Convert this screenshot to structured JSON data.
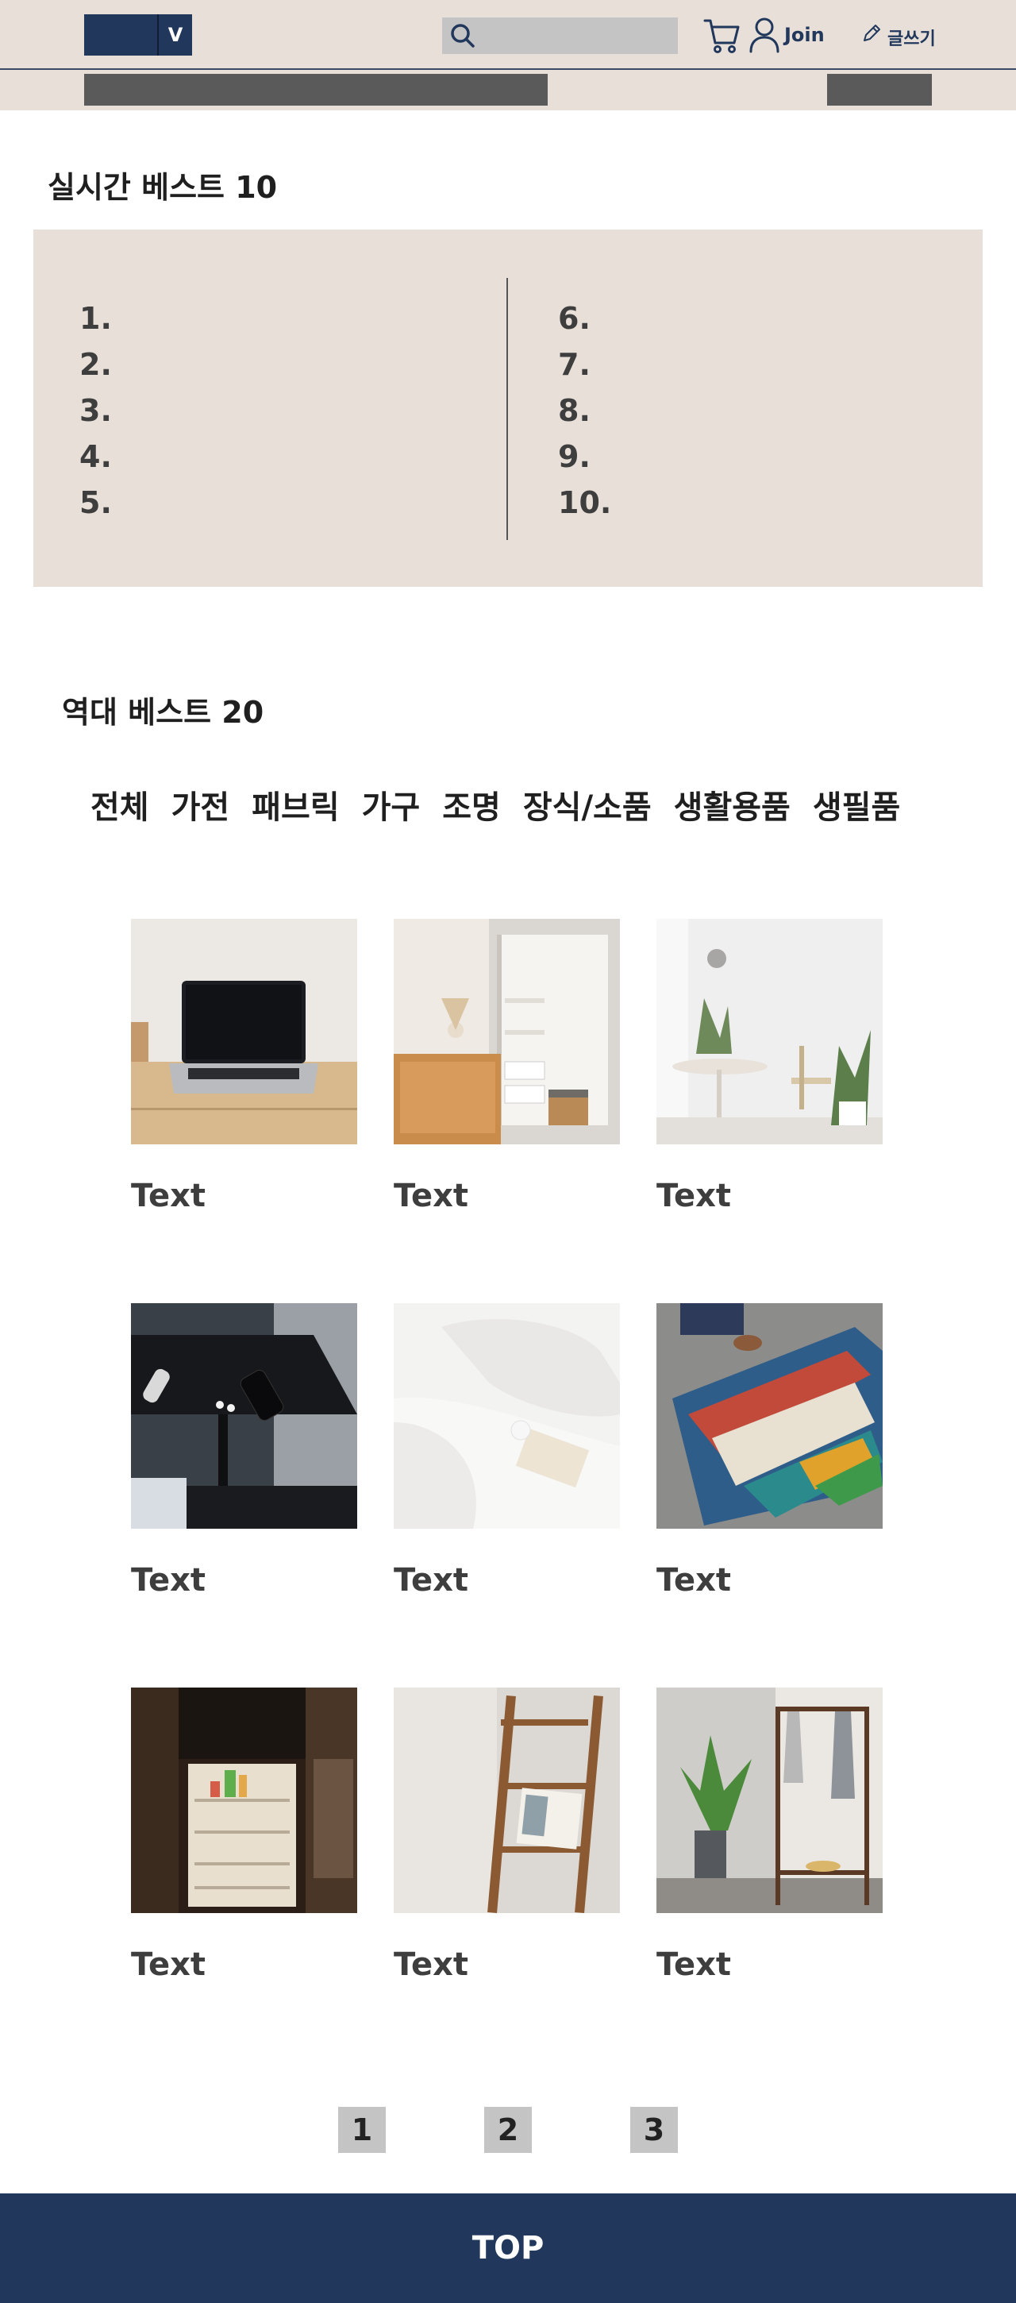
{
  "header": {
    "logo_letter": "V",
    "join_label": "Join",
    "write_label": "글쓰기",
    "search": {
      "placeholder": ""
    }
  },
  "realtime_best": {
    "title": "실시간 베스트 10",
    "ranks_left": [
      "1.",
      "2.",
      "3.",
      "4.",
      "5."
    ],
    "ranks_right": [
      "6.",
      "7.",
      "8.",
      "9.",
      "10."
    ]
  },
  "alltime_best": {
    "title": "역대 베스트 20",
    "categories": [
      "전체",
      "가전",
      "패브릭",
      "가구",
      "조명",
      "장식/소품",
      "생활용품",
      "생필품"
    ],
    "cards": [
      {
        "label": "Text",
        "image": "laptop on wooden desk"
      },
      {
        "label": "Text",
        "image": "wardrobe with rattan cabinet"
      },
      {
        "label": "Text",
        "image": "white dining room with plants"
      },
      {
        "label": "Text",
        "image": "black side table with phone and remote"
      },
      {
        "label": "Text",
        "image": "white bed with book"
      },
      {
        "label": "Text",
        "image": "patterned rug on floor"
      },
      {
        "label": "Text",
        "image": "open refrigerator"
      },
      {
        "label": "Text",
        "image": "wooden ladder shelf with magazine"
      },
      {
        "label": "Text",
        "image": "clothing rack with plant"
      }
    ]
  },
  "pagination": {
    "pages": [
      "1",
      "2",
      "3"
    ]
  },
  "footer": {
    "top_label": "TOP"
  },
  "colors": {
    "beige": "#e8e0d8",
    "navy": "#21385c",
    "gray_button": "#c4c4c4"
  }
}
